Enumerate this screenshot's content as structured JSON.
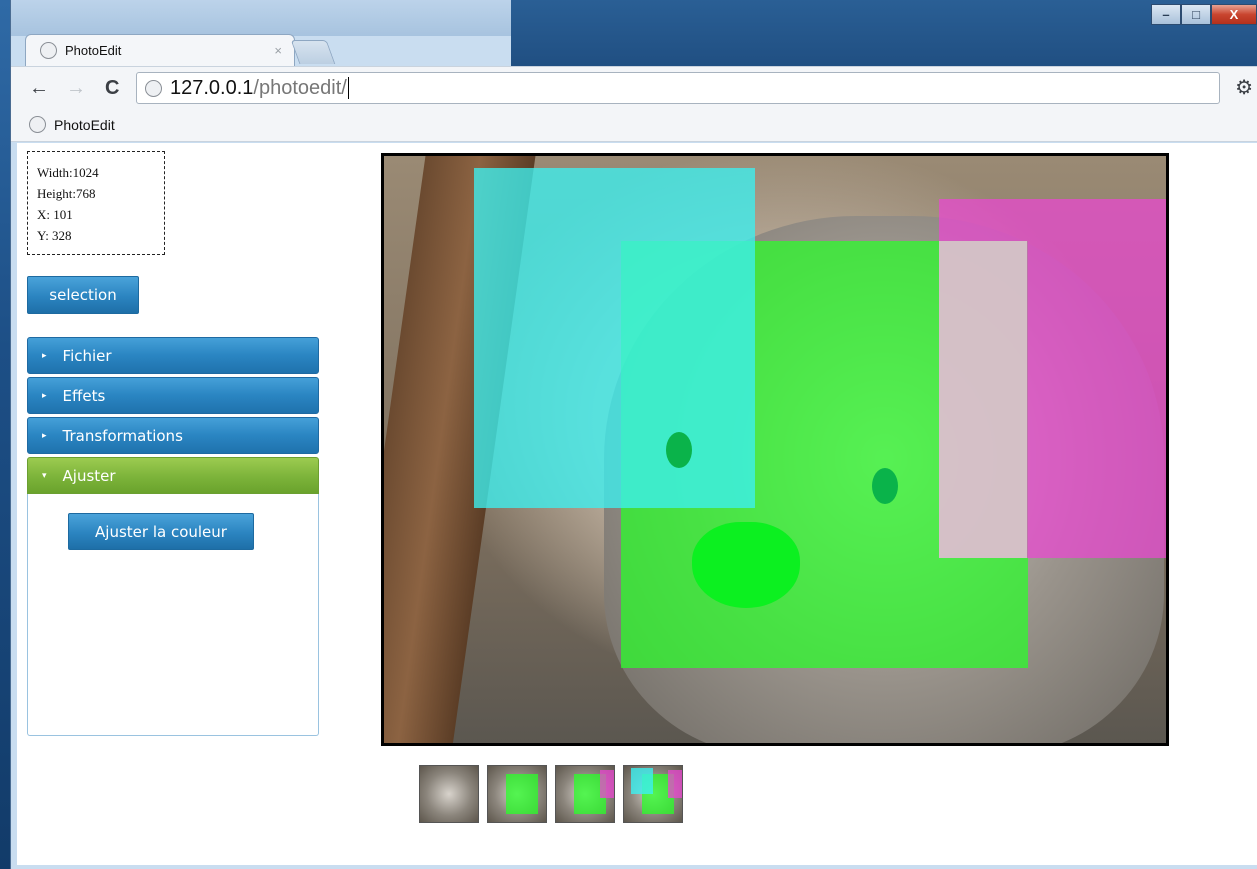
{
  "browser": {
    "tab_title": "PhotoEdit",
    "tab_close": "×",
    "url_host": "127.0.0.1",
    "url_path": "/photoedit/",
    "bookmark_label": "PhotoEdit"
  },
  "window_controls": {
    "minimize": "–",
    "maximize": "□",
    "close": "X"
  },
  "nav": {
    "back": "←",
    "forward": "→",
    "reload": "C",
    "wrench": "🔧"
  },
  "info": {
    "width_line": "Width:1024",
    "height_line": "Height:768",
    "x_line": "X: 101",
    "y_line": "Y: 328"
  },
  "buttons": {
    "selection": "selection",
    "adjust_color": "Ajuster la couleur"
  },
  "accordion": {
    "items": [
      {
        "label": "Fichier",
        "arrow": "▸"
      },
      {
        "label": "Effets",
        "arrow": "▸"
      },
      {
        "label": "Transformations",
        "arrow": "▸"
      },
      {
        "label": "Ajuster",
        "arrow": "▾"
      }
    ]
  },
  "colors": {
    "accordion_blue": "#2a85c2",
    "accordion_active_green": "#7cb33a",
    "overlay_cyan": "#3cf0f0",
    "overlay_green": "#28ff28",
    "overlay_magenta": "#eb46d2"
  },
  "thumbnails": {
    "count": 4
  }
}
